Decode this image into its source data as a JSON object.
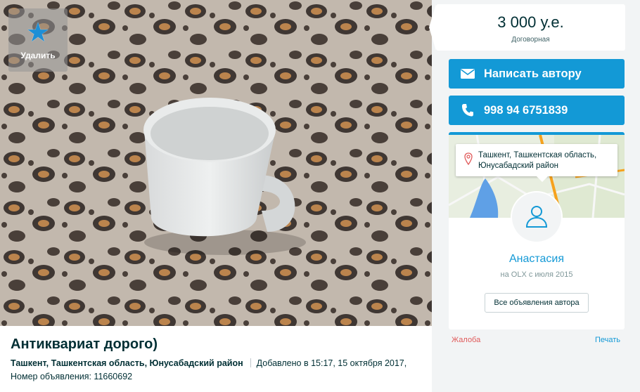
{
  "favorite": {
    "label": "Удалить",
    "icon": "star-icon",
    "accent": "#1e8fd6"
  },
  "listing": {
    "title": "Антиквариат дорого)",
    "location": "Ташкент, Ташкентская область, Юнусабадский район",
    "added": "Добавлено в 15:17, 15 октября 2017,",
    "ad_number": "Номер объявления: 11660692"
  },
  "price": {
    "amount": "3 000 у.е.",
    "negotiable": "Договорная"
  },
  "actions": {
    "message_label": "Написать автору",
    "message_icon": "envelope-icon",
    "phone_label": "998 94 6751839",
    "phone_icon": "phone-icon",
    "accent": "#1399d6"
  },
  "seller": {
    "address": "Ташкент, Ташкентская область, Юнусабадский район",
    "name": "Анастасия",
    "since": "на OLX с июля 2015",
    "all_ads_label": "Все объявления автора",
    "avatar_icon": "user-icon",
    "pin_icon": "map-pin-icon"
  },
  "footer_links": {
    "complain": "Жалоба",
    "print": "Печать"
  }
}
